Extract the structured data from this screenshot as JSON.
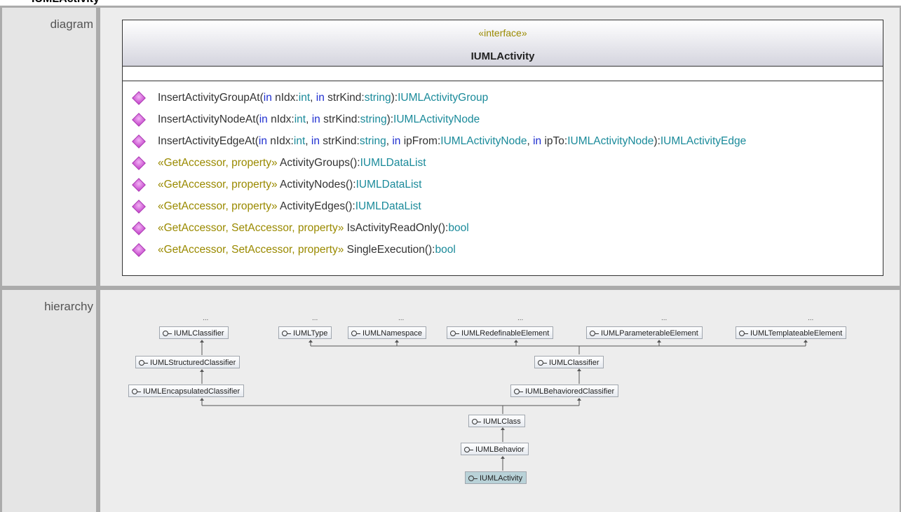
{
  "page": {
    "title_fragment": "IUMLActivity"
  },
  "diagram_section": {
    "label": "diagram",
    "stereotype": "«interface»",
    "name": "IUMLActivity",
    "operations": [
      {
        "stereo": "",
        "name": "InsertActivityGroupAt",
        "p1": "(",
        "kw1": "in",
        "a1": " nIdx:",
        "t1": "int",
        "c1": ", ",
        "kw2": "in",
        "a2": " strKind:",
        "t2": "string",
        "c2": "):",
        "ret": "IUMLActivityGroup",
        "extra": ""
      },
      {
        "stereo": "",
        "name": "InsertActivityNodeAt",
        "p1": "(",
        "kw1": "in",
        "a1": " nIdx:",
        "t1": "int",
        "c1": ", ",
        "kw2": "in",
        "a2": " strKind:",
        "t2": "string",
        "c2": "):",
        "ret": "IUMLActivityNode",
        "extra": ""
      },
      {
        "stereo": "",
        "name": "InsertActivityEdgeAt",
        "p1": "(",
        "kw1": "in",
        "a1": " nIdx:",
        "t1": "int",
        "c1": ", ",
        "kw2": "in",
        "a2": " strKind:",
        "t2": "string",
        "c2": ", ",
        "ret": "",
        "extra": "edge"
      },
      {
        "stereo": "«GetAccessor, property» ",
        "name": "ActivityGroups",
        "p1": "():",
        "ret": "IUMLDataList"
      },
      {
        "stereo": "«GetAccessor, property» ",
        "name": "ActivityNodes",
        "p1": "():",
        "ret": "IUMLDataList"
      },
      {
        "stereo": "«GetAccessor, property» ",
        "name": "ActivityEdges",
        "p1": "():",
        "ret": "IUMLDataList"
      },
      {
        "stereo": "«GetAccessor, SetAccessor, property» ",
        "name": "IsActivityReadOnly",
        "p1": "():",
        "ret": "bool"
      },
      {
        "stereo": "«GetAccessor, SetAccessor, property» ",
        "name": "SingleExecution",
        "p1": "():",
        "ret": "bool"
      }
    ],
    "edge_op_tail": {
      "kw3": "in",
      "a3": " ipFrom:",
      "t3": "IUMLActivityNode",
      "c3": ", ",
      "kw4": "in",
      "a4": " ipTo:",
      "t4": "IUMLActivityNode",
      "c4": "):",
      "ret": "IUMLActivityEdge"
    }
  },
  "hierarchy_section": {
    "label": "hierarchy",
    "more": "...",
    "nodes": {
      "classifier_left": "IUMLClassifier",
      "type": "IUMLType",
      "namespace": "IUMLNamespace",
      "redefinable": "IUMLRedefinableElement",
      "parameterable": "IUMLParameterableElement",
      "templateable": "IUMLTemplateableElement",
      "structured": "IUMLStructuredClassifier",
      "classifier_right": "IUMLClassifier",
      "encapsulated": "IUMLEncapsulatedClassifier",
      "behaviored": "IUMLBehavioredClassifier",
      "class": "IUMLClass",
      "behavior": "IUMLBehavior",
      "activity": "IUMLActivity"
    }
  }
}
